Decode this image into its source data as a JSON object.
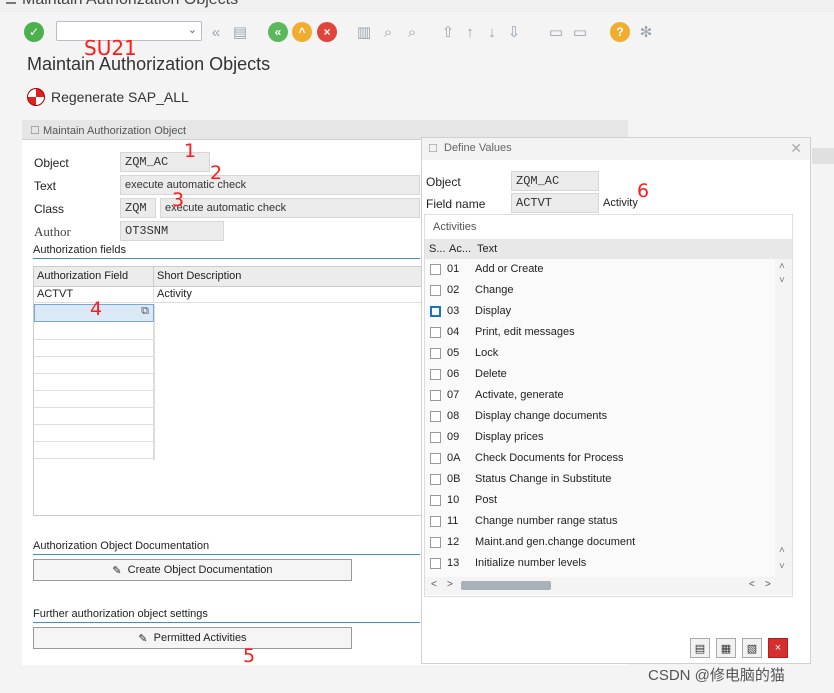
{
  "window": {
    "title": "Maintain Authorization Objects"
  },
  "toolbar": {
    "command_value": ""
  },
  "annotations": {
    "a1": "SU21",
    "a2": "1",
    "a3": "2",
    "a4": "3",
    "a5": "4",
    "a6": "5",
    "a7": "6"
  },
  "page": {
    "title": "Maintain Authorization Objects",
    "regen_label": "Regenerate SAP_ALL"
  },
  "left": {
    "panel_title": "Maintain Authorization Object",
    "object_label": "Object",
    "object_value": "ZQM_AC",
    "text_label": "Text",
    "text_value": "execute automatic check",
    "class_label": "Class",
    "class_code": "ZQM",
    "class_text": "execute automatic check",
    "author_label": "Author",
    "author_value": "OT3SNM",
    "fields_heading": "Authorization fields",
    "col1": "Authorization Field",
    "col2": "Short Description",
    "rows": [
      {
        "field": "ACTVT",
        "desc": "Activity"
      }
    ],
    "doc_heading": "Authorization Object Documentation",
    "doc_button": "Create Object Documentation",
    "further_heading": "Further authorization object settings",
    "permitted_button": "Permitted Activities"
  },
  "dialog": {
    "title": "Define Values",
    "object_label": "Object",
    "object_value": "ZQM_AC",
    "field_label": "Field name",
    "field_value": "ACTVT",
    "field_desc": "Activity",
    "tab": "Activities",
    "col_s": "S...",
    "col_ac": "Ac...",
    "col_text": "Text",
    "items": [
      {
        "code": "01",
        "text": "Add or Create"
      },
      {
        "code": "02",
        "text": "Change"
      },
      {
        "code": "03",
        "text": "Display"
      },
      {
        "code": "04",
        "text": "Print, edit messages"
      },
      {
        "code": "05",
        "text": "Lock"
      },
      {
        "code": "06",
        "text": "Delete"
      },
      {
        "code": "07",
        "text": "Activate, generate"
      },
      {
        "code": "08",
        "text": "Display change documents"
      },
      {
        "code": "09",
        "text": "Display prices"
      },
      {
        "code": "0A",
        "text": "Check Documents for Process"
      },
      {
        "code": "0B",
        "text": "Status Change in Substitute"
      },
      {
        "code": "10",
        "text": "Post"
      },
      {
        "code": "11",
        "text": "Change number range status"
      },
      {
        "code": "12",
        "text": "Maint.and gen.change document"
      },
      {
        "code": "13",
        "text": "Initialize number levels"
      }
    ]
  },
  "watermark": "CSDN @修电脑的猫"
}
